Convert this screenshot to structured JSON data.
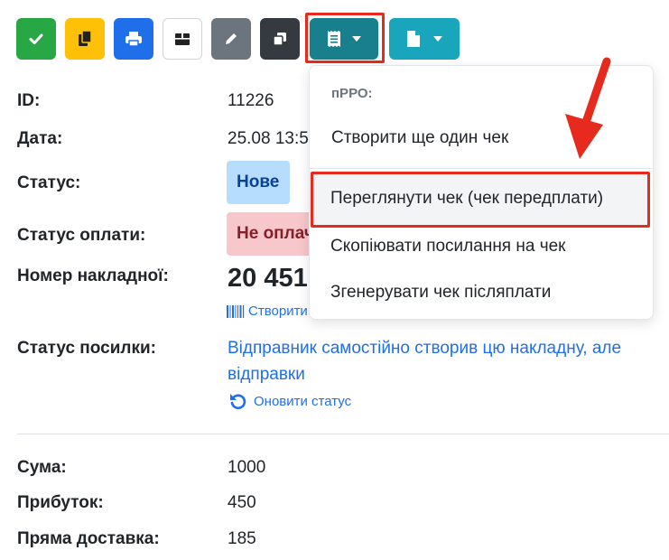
{
  "toolbar": {
    "buttons": [
      {
        "icon": "check-icon",
        "color": "#28a745"
      },
      {
        "icon": "copy-icon",
        "color": "#ffc107"
      },
      {
        "icon": "print-icon",
        "color": "#1f6feb"
      },
      {
        "icon": "box-icon",
        "color": "#ffffff"
      },
      {
        "icon": "pencil-icon",
        "color": "#6c757d"
      },
      {
        "icon": "duplicate-icon",
        "color": "#343a40"
      },
      {
        "icon": "receipt-dropdown-icon",
        "color": "#17808c"
      },
      {
        "icon": "document-dropdown-icon",
        "color": "#19a6bd"
      }
    ]
  },
  "order": {
    "id_label": "ID:",
    "id_value": "11226",
    "date_label": "Дата:",
    "date_value": "25.08 13:5",
    "status_label": "Статус:",
    "status_value": "Нове",
    "payment_status_label": "Статус оплати:",
    "payment_status_value": "Не оплач",
    "waybill_label": "Номер накладної:",
    "waybill_value": "20 451",
    "create_barcode_link": "Створити",
    "parcel_status_label": "Статус посилки:",
    "parcel_status_line1": "Відправник самостійно створив цю накладну, але",
    "parcel_status_line2": "відправки",
    "refresh_status_link": "Оновити статус",
    "sum_label": "Сума:",
    "sum_value": "1000",
    "profit_label": "Прибуток:",
    "profit_value": "450",
    "direct_delivery_label": "Пряма доставка:",
    "direct_delivery_value": "185"
  },
  "dropdown": {
    "header": "пРРО:",
    "items": [
      "Створити ще один чек",
      "Переглянути чек (чек передплати)",
      "Скопіювати посилання на чек",
      "Згенерувати чек післяплати"
    ]
  },
  "colors": {
    "highlight": "#e62b1e",
    "link": "#1f6feb"
  }
}
